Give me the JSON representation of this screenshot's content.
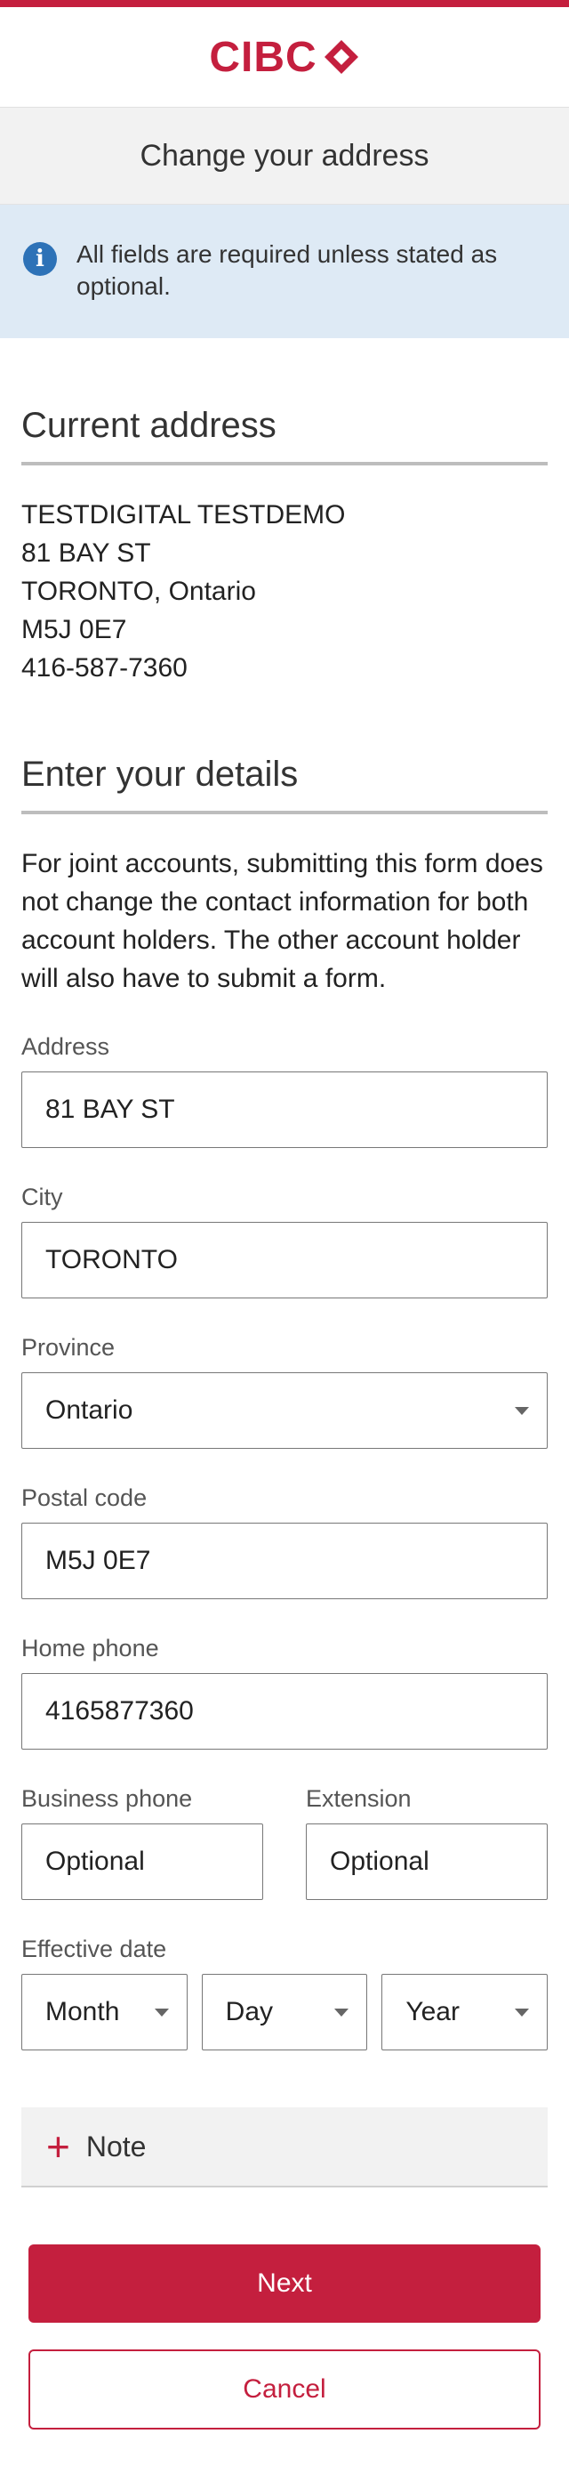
{
  "brand": {
    "name": "CIBC",
    "accent": "#c41f3e"
  },
  "page_title": "Change your address",
  "info_banner": {
    "icon": "info-icon",
    "text": "All fields are required unless stated as optional."
  },
  "current_address": {
    "heading": "Current address",
    "lines": [
      "TESTDIGITAL TESTDEMO",
      "81 BAY ST",
      "TORONTO, Ontario",
      "M5J 0E7",
      "416-587-7360"
    ]
  },
  "details": {
    "heading": "Enter your details",
    "intro": "For joint accounts, submitting this form does not change the contact information for both account holders. The other account holder will also have to submit a form."
  },
  "form": {
    "address": {
      "label": "Address",
      "value": "81 BAY ST"
    },
    "city": {
      "label": "City",
      "value": "TORONTO"
    },
    "province": {
      "label": "Province",
      "value": "Ontario"
    },
    "postal_code": {
      "label": "Postal code",
      "value": "M5J 0E7"
    },
    "home_phone": {
      "label": "Home phone",
      "value": "4165877360"
    },
    "business_phone": {
      "label": "Business phone",
      "placeholder": "Optional"
    },
    "extension": {
      "label": "Extension",
      "placeholder": "Optional"
    },
    "effective_date": {
      "label": "Effective date",
      "month": "Month",
      "day": "Day",
      "year": "Year"
    }
  },
  "note": {
    "icon": "plus-icon",
    "label": "Note"
  },
  "buttons": {
    "next": "Next",
    "cancel": "Cancel"
  }
}
